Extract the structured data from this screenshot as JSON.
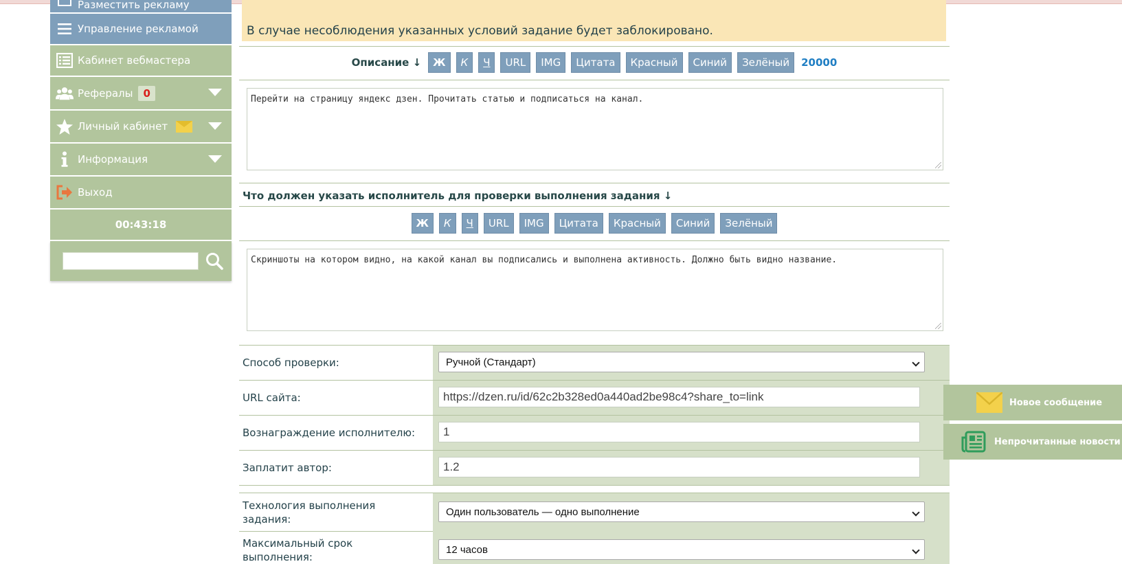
{
  "sidebar": {
    "items": [
      {
        "label": "Разместить рекламу",
        "icon": "folder-icon"
      },
      {
        "label": "Управление рекламой",
        "icon": "menu-icon"
      },
      {
        "label": "Кабинет вебмастера",
        "icon": "list-icon"
      },
      {
        "label": "Рефералы",
        "icon": "users-icon",
        "badge": "0"
      },
      {
        "label": "Личный кабинет",
        "icon": "star-icon"
      },
      {
        "label": "Информация",
        "icon": "info-icon"
      },
      {
        "label": "Выход",
        "icon": "logout-icon"
      }
    ],
    "timer": "00:43:18",
    "search_placeholder": ""
  },
  "notice": {
    "text": "В случае несоблюдения указанных условий задание будет заблокировано."
  },
  "description": {
    "label": "Описание ↓",
    "buttons": [
      "Ж",
      "К",
      "Ч",
      "URL",
      "IMG",
      "Цитата",
      "Красный",
      "Синий",
      "Зелёный"
    ],
    "counter": "20000",
    "text": "Перейти на страницу яндекс дзен. Прочитать статью и подписаться на канал."
  },
  "verification": {
    "title": "Что должен указать исполнитель для проверки выполнения задания ↓",
    "buttons": [
      "Ж",
      "К",
      "Ч",
      "URL",
      "IMG",
      "Цитата",
      "Красный",
      "Синий",
      "Зелёный"
    ],
    "text": "Скриншоты на котором видно, на какой канал вы подписались и выполнена активность. Должно быть видно название."
  },
  "form": {
    "method_label": "Способ проверки:",
    "method_value": "Ручной (Стандарт)",
    "url_label": "URL сайта:",
    "url_value": "https://dzen.ru/id/62c2b328ed0a440ad2be98c4?share_to=link",
    "reward_label": "Вознаграждение исполнителю:",
    "reward_value": "1",
    "author_pay_label": "Заплатит автор:",
    "author_pay_value": "1.2",
    "tech_label": "Технология выполнения задания:",
    "tech_value": "Один пользователь — одно выполнение",
    "deadline_label": "Максимальный срок выполнения:",
    "deadline_value": "12 часов"
  },
  "floating": {
    "new_message": "Новое сообщение",
    "unread_news": "Непрочитанные новости"
  },
  "colors": {
    "sidebar_blue": "#7f9fbb",
    "sidebar_green": "#b2c59d",
    "notice_bg": "#fae6b6",
    "form_cell_bg": "#d6e0c9",
    "counter_blue": "#1f7ec3",
    "badge_red": "#d9201c",
    "envelope_yellow": "#f3d14b",
    "news_green": "#2f9c5b",
    "logout_orange": "#e9773f"
  }
}
